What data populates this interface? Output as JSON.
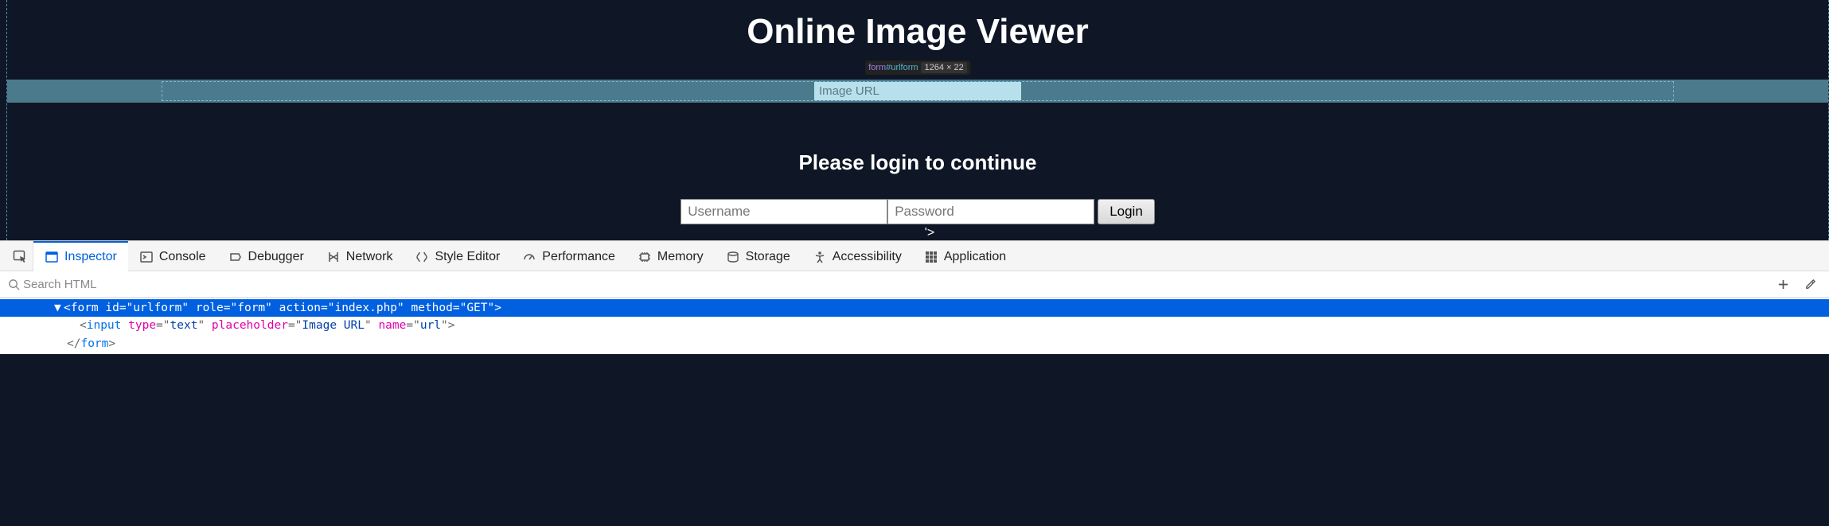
{
  "page": {
    "title": "Online Image Viewer",
    "inspect_tooltip": {
      "tag": "form",
      "id": "#urlform",
      "dims": "1264 × 22"
    },
    "url_input_placeholder": "Image URL",
    "login_heading": "Please login to continue",
    "username_placeholder": "Username",
    "password_placeholder": "Password",
    "login_button": "Login",
    "stray": "'>"
  },
  "devtools": {
    "tabs": {
      "inspector": "Inspector",
      "console": "Console",
      "debugger": "Debugger",
      "network": "Network",
      "style": "Style Editor",
      "performance": "Performance",
      "memory": "Memory",
      "storage": "Storage",
      "accessibility": "Accessibility",
      "application": "Application"
    },
    "search_placeholder": "Search HTML",
    "code": {
      "line1_open": "<form",
      "line1_attrs": " id=\"urlform\" role=\"form\" action=\"index.php\" method=\"GET\">",
      "line1_full": "<form id=\"urlform\" role=\"form\" action=\"index.php\" method=\"GET\">",
      "line2": "<input type=\"text\" placeholder=\"Image URL\" name=\"url\">",
      "line3": "</form>"
    }
  }
}
